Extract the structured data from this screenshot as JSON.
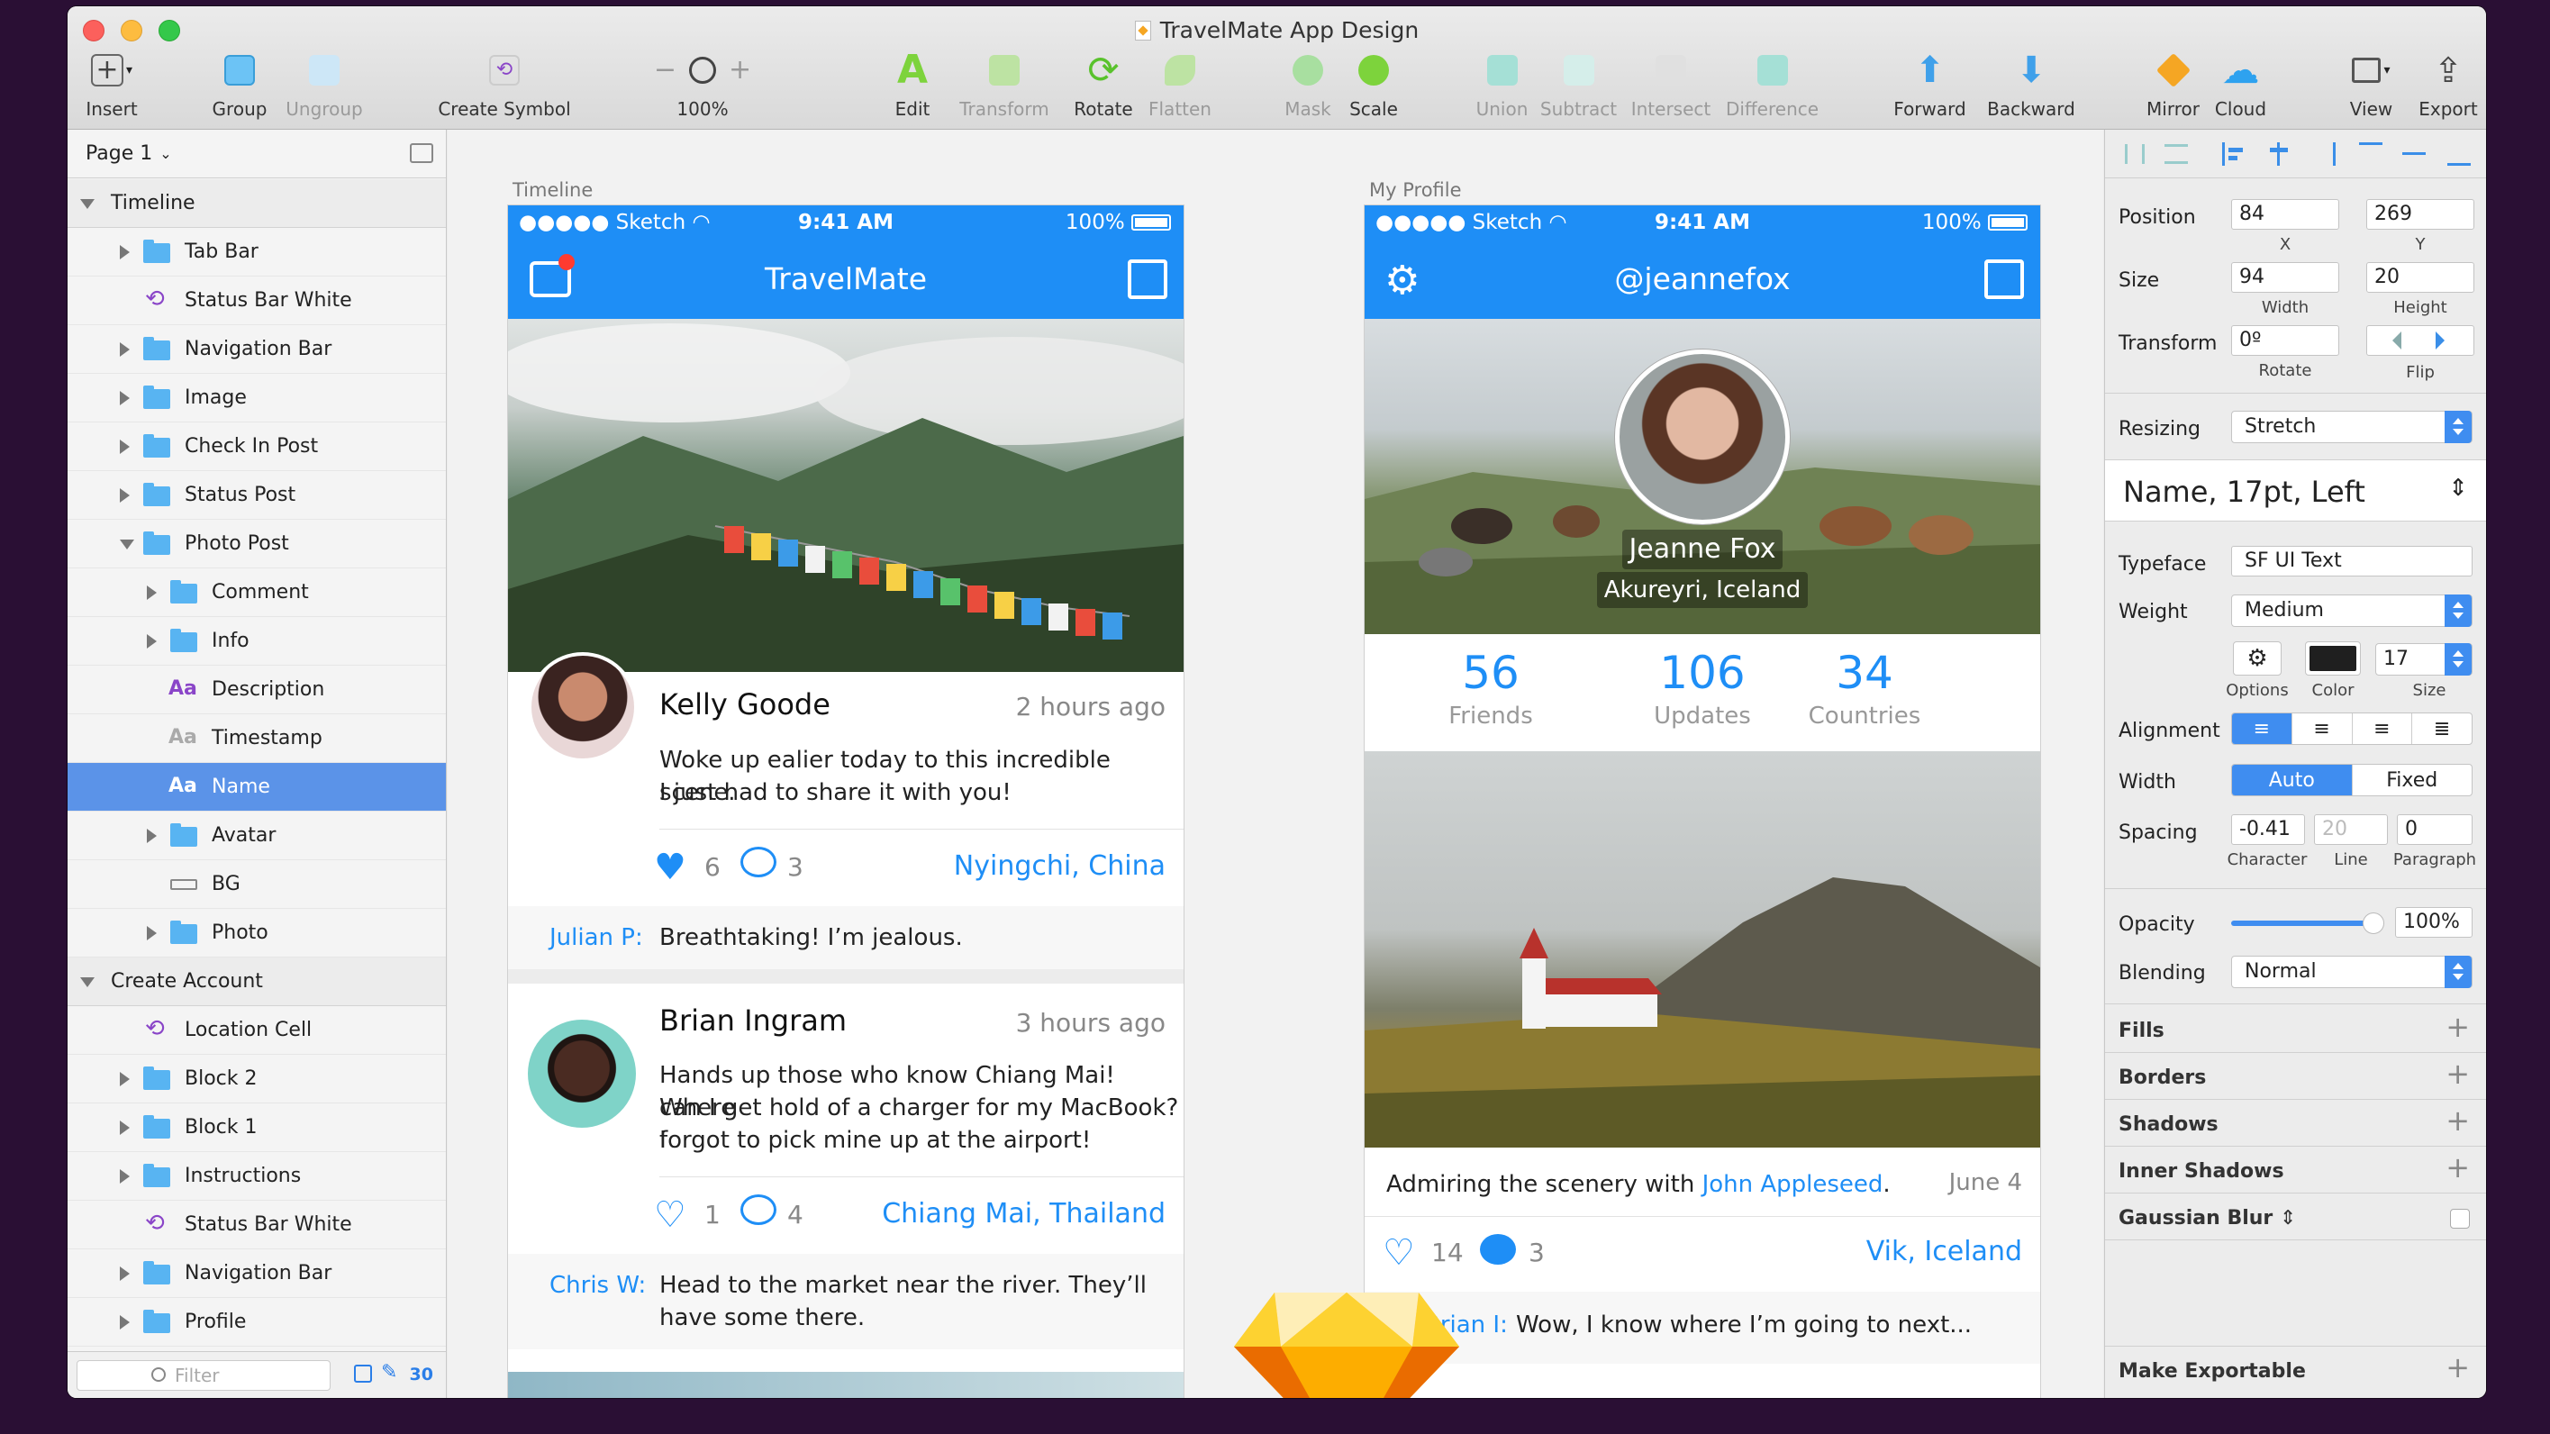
{
  "window": {
    "title": "TravelMate App Design"
  },
  "toolbar": {
    "insert": "Insert",
    "group": "Group",
    "ungroup": "Ungroup",
    "create_symbol": "Create Symbol",
    "zoom": "100%",
    "edit": "Edit",
    "transform": "Transform",
    "rotate": "Rotate",
    "flatten": "Flatten",
    "mask": "Mask",
    "scale": "Scale",
    "union": "Union",
    "subtract": "Subtract",
    "intersect": "Intersect",
    "difference": "Difference",
    "forward": "Forward",
    "backward": "Backward",
    "mirror": "Mirror",
    "cloud": "Cloud",
    "view": "View",
    "export": "Export"
  },
  "layers_panel": {
    "page": "Page 1",
    "items": [
      {
        "label": "Timeline"
      },
      {
        "label": "Tab Bar"
      },
      {
        "label": "Status Bar White"
      },
      {
        "label": "Navigation Bar"
      },
      {
        "label": "Image"
      },
      {
        "label": "Check In Post"
      },
      {
        "label": "Status Post"
      },
      {
        "label": "Photo Post"
      },
      {
        "label": "Comment"
      },
      {
        "label": "Info"
      },
      {
        "label": "Description"
      },
      {
        "label": "Timestamp"
      },
      {
        "label": "Name"
      },
      {
        "label": "Avatar"
      },
      {
        "label": "BG"
      },
      {
        "label": "Photo"
      },
      {
        "label": "Create Account"
      },
      {
        "label": "Location Cell"
      },
      {
        "label": "Block 2"
      },
      {
        "label": "Block 1"
      },
      {
        "label": "Instructions"
      },
      {
        "label": "Status Bar White"
      },
      {
        "label": "Navigation Bar"
      },
      {
        "label": "Profile"
      }
    ],
    "filter_placeholder": "Filter",
    "count": "30"
  },
  "artboards": {
    "timeline": {
      "label": "Timeline",
      "status": {
        "carrier": "●●●●● Sketch",
        "time": "9:41 AM",
        "battery": "100%"
      },
      "title": "TravelMate",
      "post1": {
        "name": "Kelly Goode",
        "time": "2 hours ago",
        "text1": "Woke up ealier today to this incredible scene.",
        "text2": "I just had to share it with you!",
        "likes": "6",
        "comments": "3",
        "location": "Nyingchi, China"
      },
      "comment1": {
        "name": "Julian P:",
        "text": "Breathtaking! I’m jealous."
      },
      "post2": {
        "name": "Brian Ingram",
        "time": "3 hours ago",
        "text1": "Hands up those who know Chiang Mai! Where",
        "text2": "can I get hold of a charger for my MacBook? I",
        "text3": "forgot to pick mine up at the airport!",
        "likes": "1",
        "comments": "4",
        "location": "Chiang Mai, Thailand"
      },
      "comment2": {
        "name": "Chris W:",
        "text1": "Head to the market near the river. They’ll",
        "text2": "have some there."
      }
    },
    "profile": {
      "label": "My Profile",
      "status": {
        "carrier": "●●●●● Sketch",
        "time": "9:41 AM",
        "battery": "100%"
      },
      "title": "@jeannefox",
      "name": "Jeanne Fox",
      "place": "Akureyri, Iceland",
      "stats": [
        {
          "n": "56",
          "l": "Friends"
        },
        {
          "n": "106",
          "l": "Updates"
        },
        {
          "n": "34",
          "l": "Countries"
        }
      ],
      "caption_pre": "Admiring the scenery with ",
      "caption_link": "John Appleseed",
      "caption_post": ".",
      "date": "June 4",
      "likes": "14",
      "comments": "3",
      "location": "Vik, Iceland",
      "comment": {
        "name": "Brian I:",
        "text": "Wow, I know where I’m going to next..."
      }
    }
  },
  "inspector": {
    "position_label": "Position",
    "x": "84",
    "y": "269",
    "x_label": "X",
    "y_label": "Y",
    "size_label": "Size",
    "width": "94",
    "height": "20",
    "width_label": "Width",
    "height_label": "Height",
    "transform_label": "Transform",
    "rotate": "0º",
    "rotate_label": "Rotate",
    "flip_label": "Flip",
    "resizing_label": "Resizing",
    "resizing": "Stretch",
    "text_style": "Name, 17pt, Left",
    "typeface_label": "Typeface",
    "typeface": "SF UI Text",
    "weight_label": "Weight",
    "weight": "Medium",
    "options_label": "Options",
    "color_label": "Color",
    "size_small_label": "Size",
    "font_size": "17",
    "alignment_label": "Alignment",
    "width_mode_label": "Width",
    "auto": "Auto",
    "fixed": "Fixed",
    "spacing_label": "Spacing",
    "character": "-0.41",
    "line": "20",
    "paragraph": "0",
    "character_label": "Character",
    "line_label": "Line",
    "paragraph_label": "Paragraph",
    "opacity_label": "Opacity",
    "opacity": "100%",
    "blending_label": "Blending",
    "blending": "Normal",
    "fills": "Fills",
    "borders": "Borders",
    "shadows": "Shadows",
    "inner_shadows": "Inner Shadows",
    "gaussian_blur": "Gaussian Blur",
    "make_exportable": "Make Exportable"
  },
  "colors": {
    "accent": "#1e8ef6",
    "selection": "#5b93e8",
    "symbol": "#8a45c8"
  }
}
